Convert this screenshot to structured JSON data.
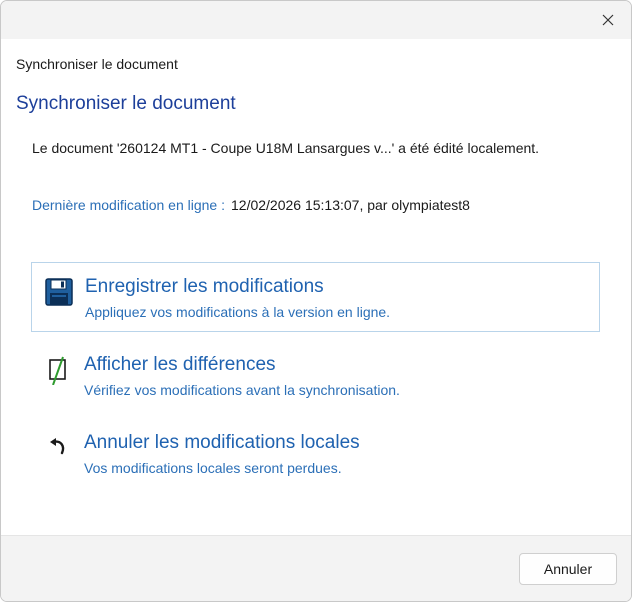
{
  "window": {
    "close_icon": "close-icon"
  },
  "header": {
    "title": "Synchroniser le document"
  },
  "main": {
    "title": "Synchroniser le document",
    "message": "Le document '260124 MT1 - Coupe U18M Lansargues v...' a été édité localement.",
    "last_modified_label": "Dernière modification en ligne :",
    "last_modified_value": "12/02/2026 15:13:07, par olympiatest8"
  },
  "commands": [
    {
      "icon": "floppy-disk-icon",
      "title": "Enregistrer les modifications",
      "subtitle": "Appliquez vos modifications à la version en ligne."
    },
    {
      "icon": "compare-diff-icon",
      "title": "Afficher les différences",
      "subtitle": "Vérifiez vos modifications avant la synchronisation."
    },
    {
      "icon": "undo-arrow-icon",
      "title": "Annuler les modifications locales",
      "subtitle": "Vos modifications locales seront perdues."
    }
  ],
  "footer": {
    "cancel_label": "Annuler"
  },
  "colors": {
    "accent": "#1f62b0",
    "title_blue": "#1d3f9a",
    "floppy_blue": "#1f5f9e",
    "diff_green": "#2e9b2e"
  }
}
